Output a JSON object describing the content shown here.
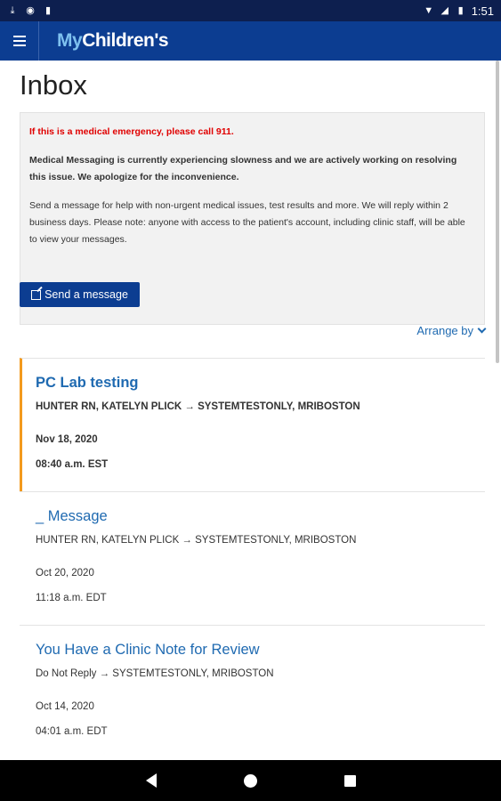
{
  "status_bar": {
    "time": "1:51",
    "left_icons": [
      "download-icon",
      "sync-icon",
      "sd-card-icon"
    ],
    "right_icons": [
      "wifi-icon",
      "signal-icon",
      "battery-icon"
    ]
  },
  "header": {
    "brand_prefix": "My",
    "brand_suffix": "Children's",
    "menu_icon": "hamburger-icon"
  },
  "page": {
    "title": "Inbox"
  },
  "notice": {
    "emergency": "If this is a medical emergency, please call 911.",
    "slowness": "Medical Messaging is currently experiencing slowness and we are actively working on resolving this issue. We apologize for the inconvenience.",
    "info": "Send a message for help with non-urgent medical issues, test results and more. We will reply within 2 business days. Please note: anyone with access to the patient's account, including clinic staff, will be able to view your messages."
  },
  "actions": {
    "send_label": "Send a message",
    "arrange_label": "Arrange by"
  },
  "messages": [
    {
      "subject": "PC Lab testing",
      "route": "HUNTER RN, KATELYN PLICK → SYSTEMTESTONLY, MRIBOSTON",
      "date": "Nov 18, 2020",
      "time": "08:40 a.m. EST",
      "unread": true
    },
    {
      "subject": "_ Message",
      "route": "HUNTER RN, KATELYN PLICK → SYSTEMTESTONLY, MRIBOSTON",
      "date": "Oct 20, 2020",
      "time": "11:18 a.m. EDT",
      "unread": false
    },
    {
      "subject": "You Have a Clinic Note for Review",
      "route": "Do Not Reply → SYSTEMTESTONLY, MRIBOSTON",
      "date": "Oct 14, 2020",
      "time": "04:01 a.m. EDT",
      "unread": false
    }
  ],
  "colors": {
    "header_bg": "#0c3d91",
    "link": "#1f6ab1",
    "unread_accent": "#f39a1e",
    "emergency": "#e00000"
  }
}
